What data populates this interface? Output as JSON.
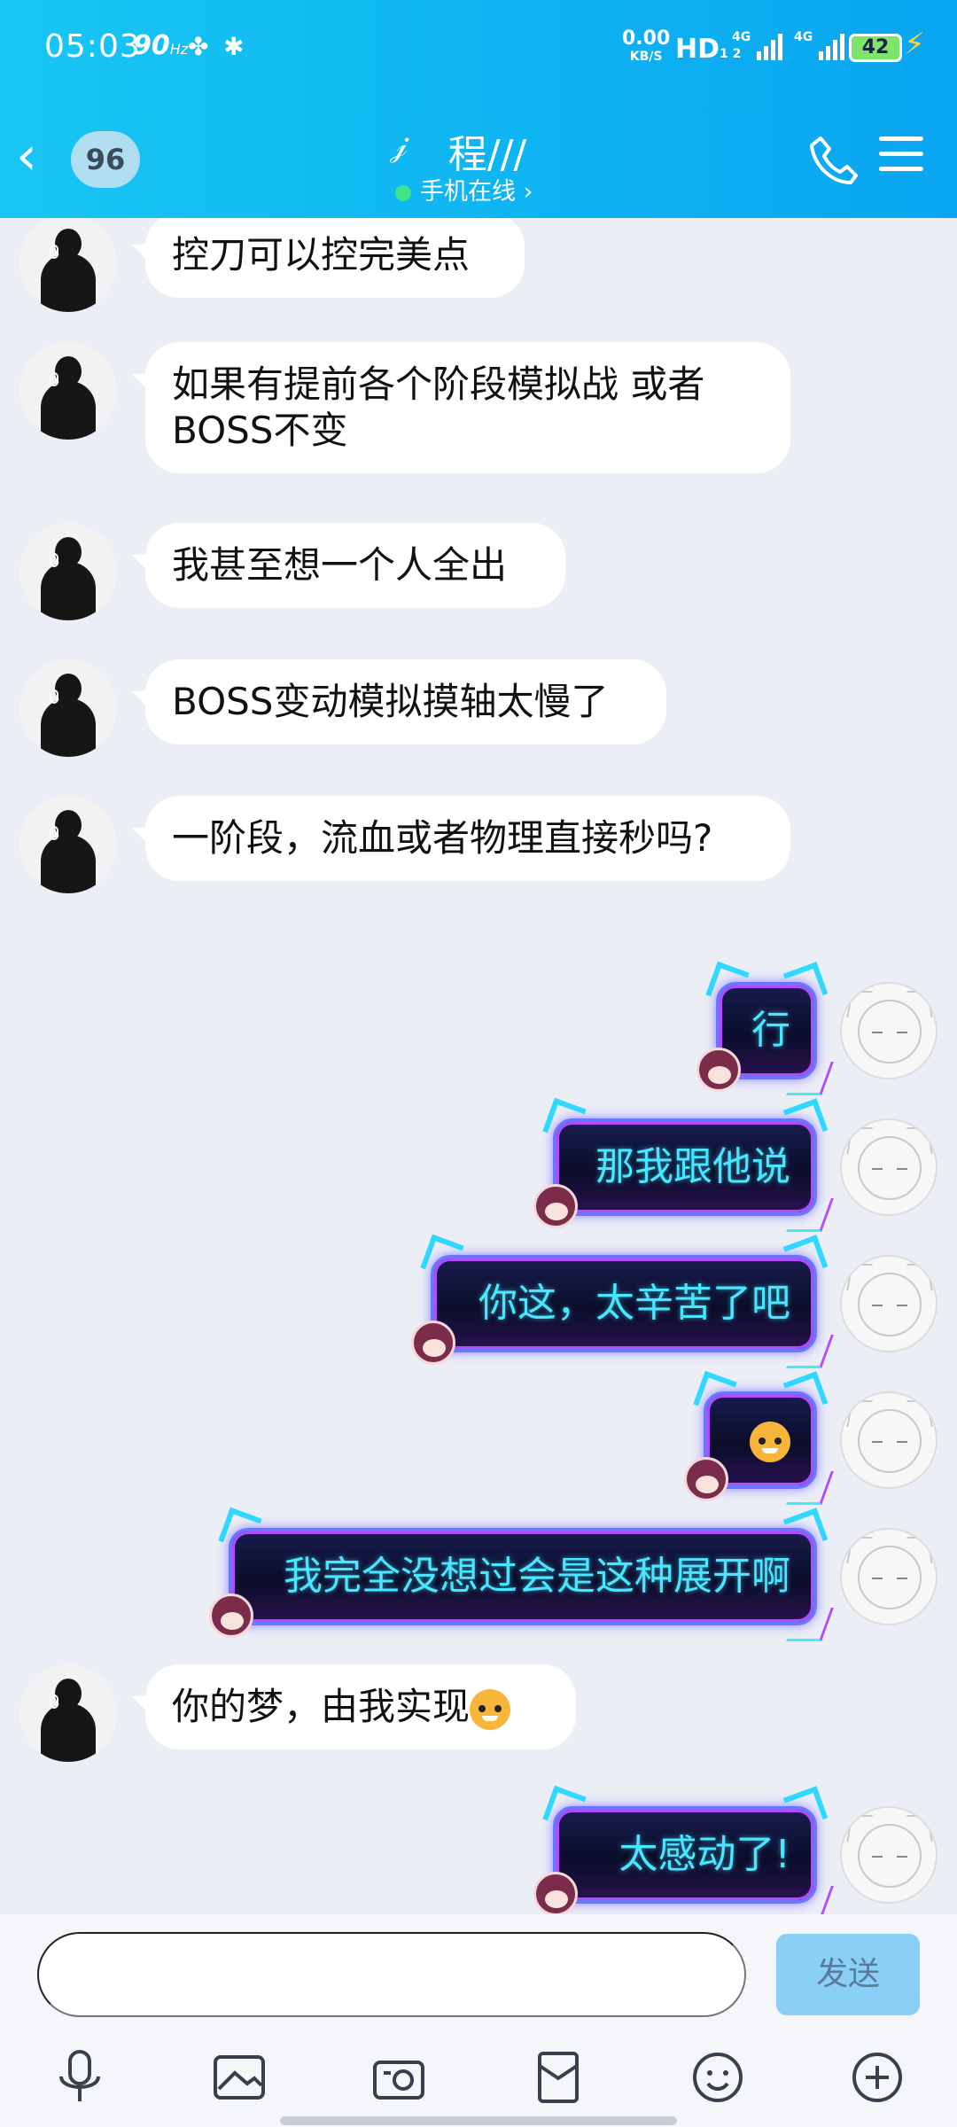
{
  "status_bar": {
    "time": "05:03",
    "refresh": "90",
    "refresh_unit": "Hz",
    "speed_value": "0.00",
    "speed_unit": "KB/S",
    "hd": "HD",
    "hd_sub": "1 2",
    "network_1": "4G",
    "network_2": "4G",
    "battery": "42"
  },
  "header": {
    "unread_count": "96",
    "contact_name": "程///",
    "presence": "手机在线",
    "presence_arrow": "›"
  },
  "messages": [
    {
      "side": "left",
      "text": "控刀可以控完美点"
    },
    {
      "side": "left",
      "text": "如果有提前各个阶段模拟战 或者BOSS不变"
    },
    {
      "side": "left",
      "text": "我甚至想一个人全出"
    },
    {
      "side": "left",
      "text": "BOSS变动模拟摸轴太慢了"
    },
    {
      "side": "left",
      "text": "一阶段，流血或者物理直接秒吗?"
    },
    {
      "side": "right",
      "text": "行"
    },
    {
      "side": "right",
      "text": "那我跟他说"
    },
    {
      "side": "right",
      "text": "你这，太辛苦了吧"
    },
    {
      "side": "right",
      "text": "",
      "emoji": "doge-emoji"
    },
    {
      "side": "right",
      "text": "我完全没想过会是这种展开啊"
    },
    {
      "side": "left",
      "text": "你的梦，由我实现",
      "emoji": "doge-emoji"
    },
    {
      "side": "right",
      "text": "太感动了!"
    }
  ],
  "composer": {
    "input_value": "",
    "send_label": "发送"
  },
  "toolbar": {
    "icons": [
      "microphone-icon",
      "image-icon",
      "camera-icon",
      "red-packet-icon",
      "emoji-icon",
      "plus-icon"
    ]
  },
  "colors": {
    "header_gradient_start": "#19c6f3",
    "header_gradient_end": "#0aa5f1",
    "chat_background": "#eceef6",
    "send_button": "#89cff6",
    "neon_text": "#49e6ff"
  }
}
